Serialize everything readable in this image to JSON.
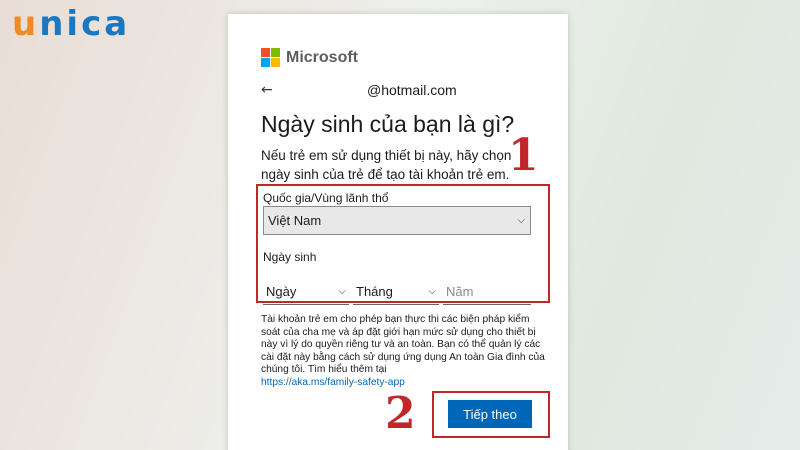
{
  "watermark": {
    "first": "u",
    "rest": "nica"
  },
  "brand": {
    "name": "Microsoft",
    "logo_colors": [
      "#f25022",
      "#7fba00",
      "#00a4ef",
      "#ffb900"
    ]
  },
  "identity": {
    "back_glyph": "←",
    "email": "@hotmail.com"
  },
  "heading": {
    "title": "Ngày sinh của bạn là gì?"
  },
  "description": "Nếu trẻ em sử dụng thiết bị này, hãy chọn ngày sinh của trẻ để tạo tài khoản trẻ em.",
  "country": {
    "label": "Quốc gia/Vùng lãnh thổ",
    "value": "Việt Nam"
  },
  "birthdate": {
    "label": "Ngày sinh",
    "day": "Ngày",
    "month": "Tháng",
    "year_placeholder": "Năm"
  },
  "info": {
    "text": "Tài khoản trẻ em cho phép bạn thực thi các biện pháp kiểm soát của cha mẹ và áp đặt giới hạn mức sử dụng cho thiết bị này vì lý do quyền riêng tư và an toàn. Bạn có thể quản lý các cài đặt này bằng cách sử dụng ứng dụng An toàn Gia đình của chúng tôi. Tìm hiểu thêm tại",
    "link": "https://aka.ms/family-safety-app"
  },
  "actions": {
    "next_label": "Tiếp theo"
  },
  "annotations": {
    "step1": "1",
    "step2": "2",
    "color": "#c0262c"
  }
}
